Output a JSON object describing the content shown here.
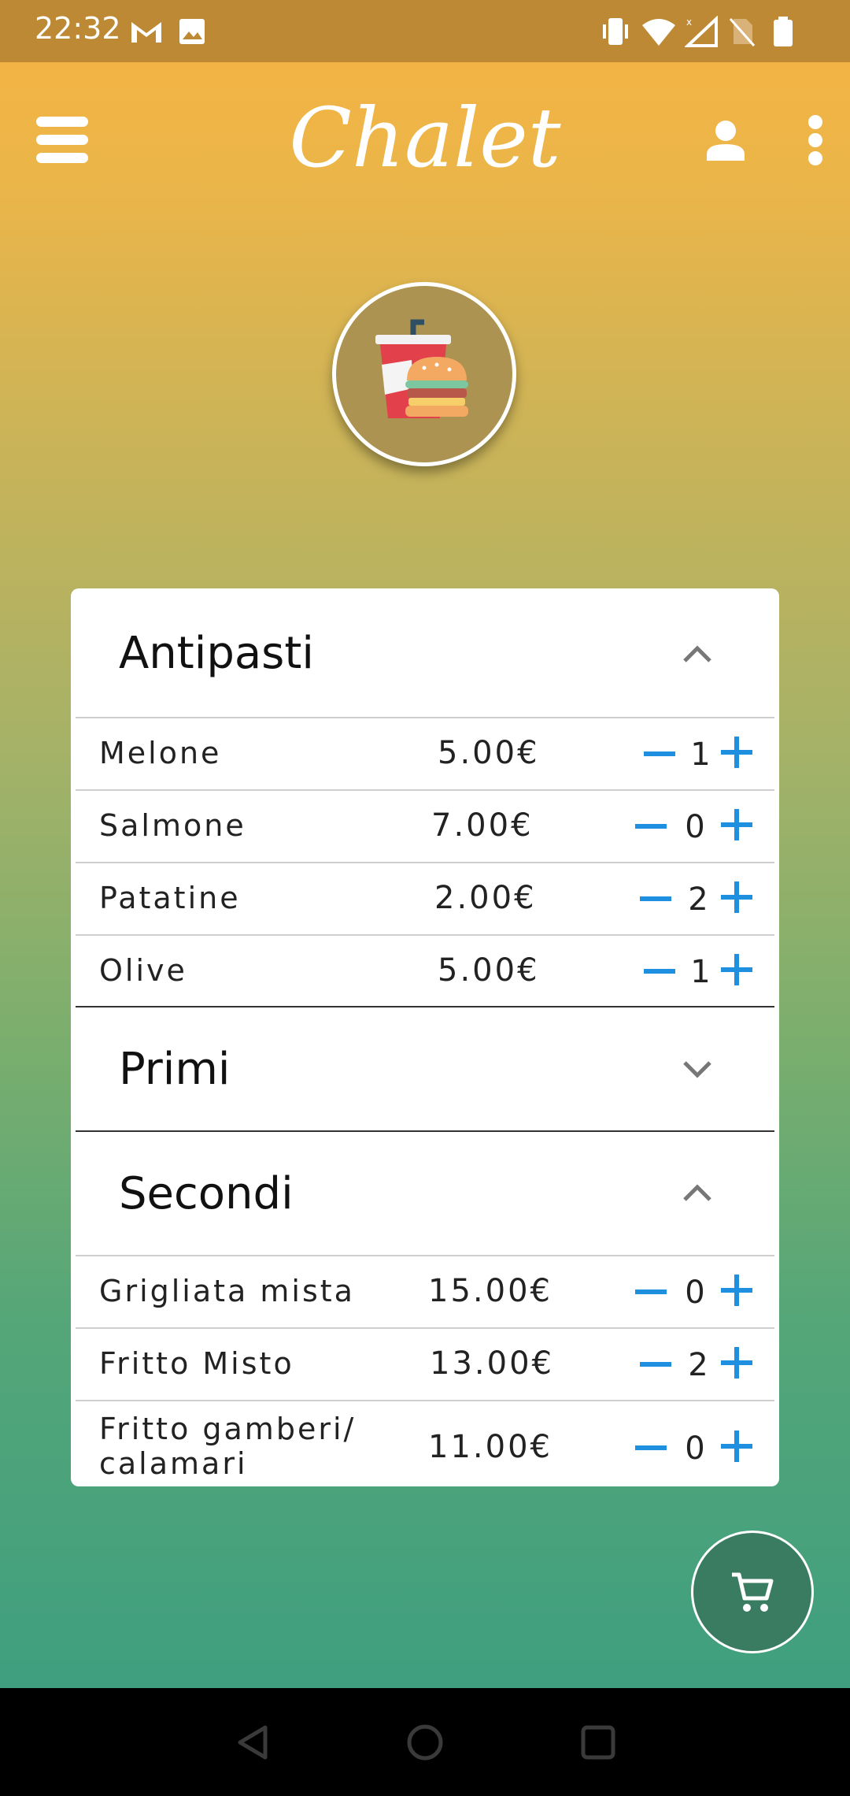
{
  "status_bar": {
    "time": "22:32"
  },
  "toolbar": {
    "title": "Chalet"
  },
  "menu": {
    "sections": [
      {
        "title": "Antipasti",
        "expanded": true,
        "items": [
          {
            "name": "Melone",
            "price": "5.00€",
            "qty": "1"
          },
          {
            "name": "Salmone",
            "price": "7.00€",
            "qty": "0"
          },
          {
            "name": "Patatine",
            "price": "2.00€",
            "qty": "2"
          },
          {
            "name": "Olive",
            "price": "5.00€",
            "qty": "1"
          }
        ]
      },
      {
        "title": "Primi",
        "expanded": false,
        "items": []
      },
      {
        "title": "Secondi",
        "expanded": true,
        "items": [
          {
            "name": "Grigliata mista",
            "price": "15.00€",
            "qty": "0"
          },
          {
            "name": "Fritto Misto",
            "price": "13.00€",
            "qty": "2"
          },
          {
            "name": "Fritto gamberi/\ncalamari",
            "price": "11.00€",
            "qty": "0"
          }
        ]
      }
    ]
  },
  "colors": {
    "accent": "#1f8fe0",
    "fab": "#3a7c62",
    "statusbar": "#bd8934"
  },
  "icons": {
    "menu": "hamburger-icon",
    "user": "person-icon",
    "more": "more-vert-icon",
    "cart": "shopping-cart-icon",
    "avatar": "fast-food-icon"
  }
}
